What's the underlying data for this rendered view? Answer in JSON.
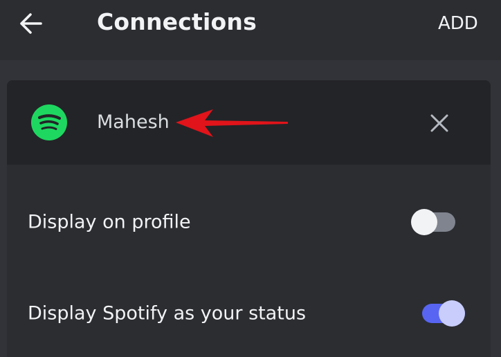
{
  "header": {
    "title": "Connections",
    "add_label": "ADD"
  },
  "connection": {
    "service_icon": "spotify-icon",
    "account_name": "Mahesh",
    "remove_icon": "close-icon",
    "annotation": "red-arrow"
  },
  "settings": [
    {
      "label": "Display on profile",
      "enabled": false
    },
    {
      "label": "Display Spotify as your status",
      "enabled": true
    }
  ],
  "colors": {
    "background": "#313338",
    "header": "#2b2d31",
    "card_header": "#232428",
    "spotify_green": "#1ed760",
    "accent": "#5865f2",
    "arrow_red": "#e0141a"
  }
}
